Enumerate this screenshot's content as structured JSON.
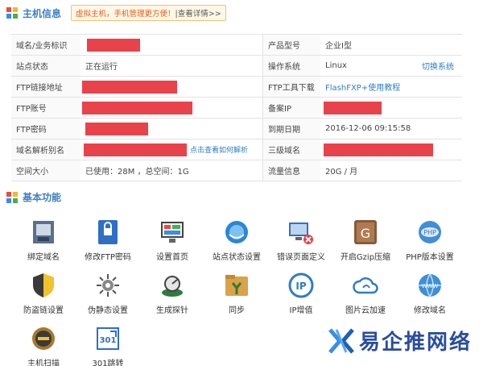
{
  "host_info": {
    "title": "主机信息",
    "notice": {
      "highlight": "虚拟主机，手机管理更方便！",
      "link": "查看详情>>"
    }
  },
  "table": {
    "rows": [
      {
        "l1": "域名/业务标识",
        "v1": "",
        "l2": "产品型号",
        "v2": "企业I型",
        "action": ""
      },
      {
        "l1": "站点状态",
        "v1": "正在运行",
        "l2": "操作系统",
        "v2": "Linux",
        "action": "切换系统"
      },
      {
        "l1": "FTP链接地址",
        "v1": "",
        "l2": "FTP工具下载",
        "v2": "FlashFXP+使用教程",
        "action": ""
      },
      {
        "l1": "FTP账号",
        "v1": "",
        "l2": "备案IP",
        "v2": "",
        "action": ""
      },
      {
        "l1": "FTP密码",
        "v1": "",
        "l2": "到期日期",
        "v2": "2016-12-06 09:15:58",
        "action": ""
      },
      {
        "l1": "域名解析别名",
        "v1": "点击查看如何解析",
        "l2": "三级域名",
        "v2": "",
        "action": ""
      },
      {
        "l1": "空间大小",
        "v1": "已使用：28M ，总空间：1G",
        "l2": "流量信息",
        "v2": "20G / 月",
        "action": ""
      }
    ]
  },
  "basic_functions": {
    "title": "基本功能",
    "items": [
      {
        "label": "绑定域名",
        "icon": "bind-domain-icon"
      },
      {
        "label": "修改FTP密码",
        "icon": "ftp-password-icon"
      },
      {
        "label": "设置首页",
        "icon": "homepage-icon"
      },
      {
        "label": "站点状态设置",
        "icon": "site-status-icon"
      },
      {
        "label": "错误页面定义",
        "icon": "error-page-icon"
      },
      {
        "label": "开启Gzip压缩",
        "icon": "gzip-icon"
      },
      {
        "label": "PHP版本设置",
        "icon": "php-icon"
      },
      {
        "label": "防盗链设置",
        "icon": "anti-leech-icon"
      },
      {
        "label": "伪静态设置",
        "icon": "rewrite-icon"
      },
      {
        "label": "生成探针",
        "icon": "probe-icon"
      },
      {
        "label": "同步",
        "icon": "sync-icon"
      },
      {
        "label": "IP增值",
        "icon": "ip-icon"
      },
      {
        "label": "图片云加速",
        "icon": "cloud-icon"
      },
      {
        "label": "修改域名",
        "icon": "www-icon"
      },
      {
        "label": "主机扫描",
        "icon": "scan-icon"
      },
      {
        "label": "301跳转",
        "icon": "redirect-301-icon"
      }
    ]
  },
  "brand": {
    "text": "易企推网络",
    "logo": "brand-logo-icon"
  },
  "colors": {
    "accent": "#3b7fc4",
    "redact": "#e8424a",
    "link": "#2f7ec1"
  }
}
